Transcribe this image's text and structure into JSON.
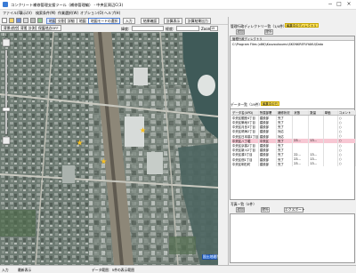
{
  "window": {
    "title": "コンクリート補修管理支援ツール（補修管理編） - 中央区周辺C(3)",
    "controls": {
      "minimize": "−",
      "maximize": "□",
      "close": "×"
    }
  },
  "menu": [
    "ファイル(F)",
    "表示(V)",
    "検索条件(M)",
    "作業選択(W)",
    "オプション(O)",
    "ヘルプ(H)"
  ],
  "toolbar": {
    "buttons": [
      "地図",
      "分割",
      "詳細",
      "地図",
      "地図モードの選択",
      "入力",
      "結果確認",
      "計算表示",
      "計算結果出力"
    ]
  },
  "map_toolbar": {
    "left_items": [
      "背景(航空)",
      "背景",
      "計測",
      "保護地点OFF"
    ],
    "lat_label": "緯度:",
    "lng_label": "経度:",
    "zoom_label": "Zoom",
    "zoom_value": "15"
  },
  "map": {
    "zoom_caption": "21",
    "map_button": "国土地理院",
    "markers": [
      "star",
      "star",
      "star"
    ]
  },
  "right_panel": {
    "dir_panel_title": "管理行政ディレクトリ一覧（1/4件）",
    "dir_badge": "編集中のディレクトリ",
    "dir_tab": "管理行政ディレクトリ",
    "dir_path": "C:\\Program Files (x86)\\Kouzoukoumu\\SKONKREFUYAKU\\Data",
    "dir_buttons": [
      "追加",
      "除外"
    ],
    "data_panel_title": "データ一覧（19件）",
    "data_badge": "編集中の行",
    "table": {
      "headers": [
        "データ名(UPD)",
        "所属部署",
        "補修状況",
        "状態",
        "数量",
        "単価",
        "コメント"
      ],
      "rows": [
        [
          "中央区銀座4丁目",
          "建設部",
          "完了",
          "",
          "",
          "",
          "○"
        ],
        [
          "中央区築地5丁目",
          "建設部",
          "完了",
          "",
          "",
          "",
          "○"
        ],
        [
          "中央区月島3丁目",
          "建設部",
          "完了",
          "",
          "",
          "",
          "○"
        ],
        [
          "中央区晴海2丁目",
          "建設部",
          "対応",
          "",
          "",
          "",
          "○"
        ],
        [
          "中央区日本橋1丁目",
          "建設部",
          "対応",
          "",
          "",
          "",
          "○"
        ],
        [
          "中央区八丁堀",
          "中央区",
          "完了",
          "23...",
          "13...",
          "",
          "○"
        ],
        [
          "中央区京橋2丁目",
          "建設部",
          "完了",
          "",
          "",
          "",
          "○"
        ],
        [
          "中央区新川2丁目",
          "建設部",
          "完了",
          "",
          "",
          "",
          "○"
        ],
        [
          "中央区湊3丁目",
          "建設部",
          "完了",
          "22...",
          "13...",
          "",
          "○"
        ],
        [
          "中央区佃1丁目",
          "建設部",
          "完了",
          "23...",
          "13...",
          "",
          "○"
        ],
        [
          "中央区明石町",
          "建設部",
          "完了",
          "23...",
          "13...",
          "",
          "○"
        ]
      ],
      "highlight_index": 5
    },
    "photo_panel_title": "写真一覧（0件）",
    "photo_buttons": [
      "追加",
      "除外",
      "エクスポート"
    ]
  },
  "status": {
    "left": "入力",
    "mid": "最新表示",
    "right": "データ範囲：5件の表示範囲"
  },
  "colors": {
    "badge": "#ffe45c",
    "highlight": "#f7c7d3",
    "map_dark": "#5c6a61"
  }
}
